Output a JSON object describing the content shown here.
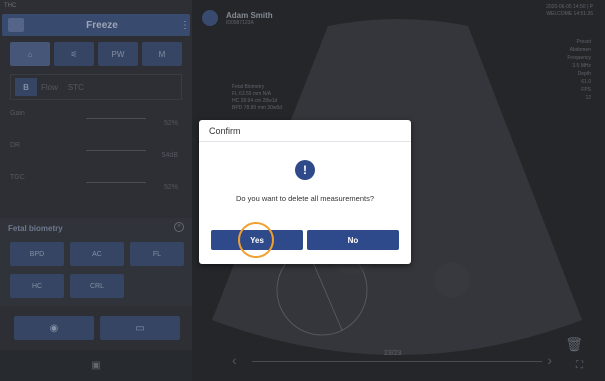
{
  "topbar": {
    "label": "THC"
  },
  "freeze": {
    "label": "Freeze"
  },
  "modes": [
    {
      "icon": "home-icon",
      "label": "⌂"
    },
    {
      "icon": "wave-icon",
      "label": "⚟"
    },
    {
      "icon": "pw-icon",
      "label": "PW"
    },
    {
      "icon": "m-icon",
      "label": "M"
    }
  ],
  "subtabs": {
    "b": "B",
    "t1": "Flow",
    "t2": "STC"
  },
  "sliders": [
    {
      "label": "Gain",
      "value": "52%"
    },
    {
      "label": "DR",
      "value": "54dB"
    },
    {
      "label": "TGC",
      "value": "52%"
    }
  ],
  "fetal": {
    "title": "Fetal biometry",
    "buttons": [
      "BPD",
      "AC",
      "FL",
      "HC",
      "CRL"
    ]
  },
  "patient": {
    "name": "Adam Smith",
    "id": "ID0987123A"
  },
  "datetime": {
    "date": "2020-06-05 14:50 | P",
    "sub": "WELCOME 14:51:26"
  },
  "params": [
    "Preset",
    "Abdomen",
    "Frequency",
    "3.5 MHz",
    "Depth",
    "61.0",
    "FPS",
    "12"
  ],
  "measurements": [
    "Fetal Biometry",
    "FL  63.55 mm N/A",
    "HC  28.94 cm 28w1d",
    "BPD 78.89 mm 30w5d"
  ],
  "pager": {
    "counter": "23/23"
  },
  "dialog": {
    "title": "Confirm",
    "icon": "!",
    "message": "Do you want to delete all measurements?",
    "yes": "Yes",
    "no": "No"
  }
}
